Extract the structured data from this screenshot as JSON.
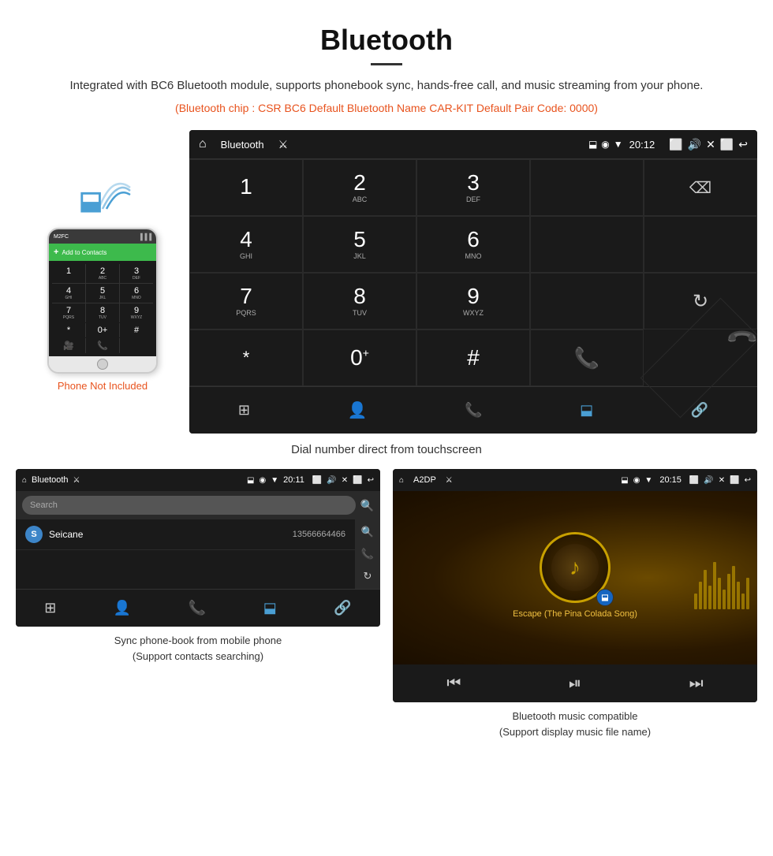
{
  "header": {
    "title": "Bluetooth",
    "description": "Integrated with BC6 Bluetooth module, supports phonebook sync, hands-free call, and music streaming from your phone.",
    "specs": "(Bluetooth chip : CSR BC6    Default Bluetooth Name CAR-KIT    Default Pair Code: 0000)"
  },
  "phone_area": {
    "not_included_label": "Phone Not Included"
  },
  "car_screen_main": {
    "app_title": "Bluetooth",
    "time": "20:12",
    "dial_keys": [
      {
        "num": "1",
        "sub": ""
      },
      {
        "num": "2",
        "sub": "ABC"
      },
      {
        "num": "3",
        "sub": "DEF"
      },
      {
        "num": "",
        "sub": ""
      },
      {
        "num": "⌫",
        "sub": ""
      },
      {
        "num": "4",
        "sub": "GHI"
      },
      {
        "num": "5",
        "sub": "JKL"
      },
      {
        "num": "6",
        "sub": "MNO"
      },
      {
        "num": "",
        "sub": ""
      },
      {
        "num": "",
        "sub": ""
      },
      {
        "num": "7",
        "sub": "PQRS"
      },
      {
        "num": "8",
        "sub": "TUV"
      },
      {
        "num": "9",
        "sub": "WXYZ"
      },
      {
        "num": "",
        "sub": ""
      },
      {
        "num": "↻",
        "sub": ""
      },
      {
        "num": "*",
        "sub": ""
      },
      {
        "num": "0",
        "sub": "+"
      },
      {
        "num": "#",
        "sub": ""
      },
      {
        "num": "📞",
        "sub": "green"
      },
      {
        "num": "📞",
        "sub": "red"
      }
    ]
  },
  "caption_main": "Dial number direct from touchscreen",
  "phonebook_screen": {
    "app_title": "Bluetooth",
    "time": "20:11",
    "search_placeholder": "Search",
    "contact": {
      "initial": "S",
      "name": "Seicane",
      "number": "13566664466"
    }
  },
  "music_screen": {
    "app_title": "A2DP",
    "time": "20:15",
    "song_title": "Escape (The Pina Colada Song)"
  },
  "bottom_captions": {
    "phonebook": "Sync phone-book from mobile phone\n(Support contacts searching)",
    "phonebook_line1": "Sync phone-book from mobile phone",
    "phonebook_line2": "(Support contacts searching)",
    "music_line1": "Bluetooth music compatible",
    "music_line2": "(Support display music file name)"
  }
}
